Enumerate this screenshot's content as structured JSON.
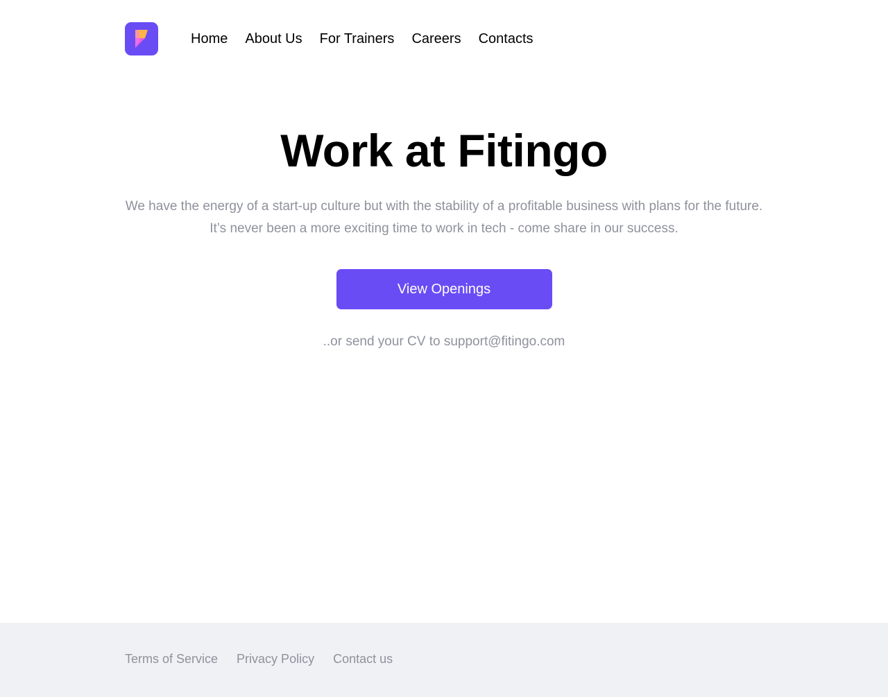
{
  "brand": {
    "logo_icon": "fitingo-logo-icon",
    "logo_bg_color": "#6a4cf5",
    "logo_accent_colors": [
      "#ffb44a",
      "#e85adf"
    ]
  },
  "nav": {
    "items": [
      {
        "label": "Home"
      },
      {
        "label": "About Us"
      },
      {
        "label": "For Trainers"
      },
      {
        "label": "Careers"
      },
      {
        "label": "Contacts"
      }
    ]
  },
  "hero": {
    "title": "Work at Fitingo",
    "description": "We have the energy of a start-up culture but with the stability of a profitable business with plans for the future. It’s never been a more exciting time to work in tech - come share in our success.",
    "cta_label": "View Openings",
    "cta_color": "#6a4cf5",
    "cv_prefix": "..or send your CV to ",
    "cv_email": "support@fitingo.com"
  },
  "footer": {
    "links": [
      {
        "label": "Terms of Service"
      },
      {
        "label": "Privacy Policy"
      },
      {
        "label": "Contact us"
      }
    ],
    "bg_color": "#f0f1f5"
  },
  "colors": {
    "accent": "#6a4cf5",
    "muted_text": "#8f919c",
    "heading_text": "#000000"
  }
}
